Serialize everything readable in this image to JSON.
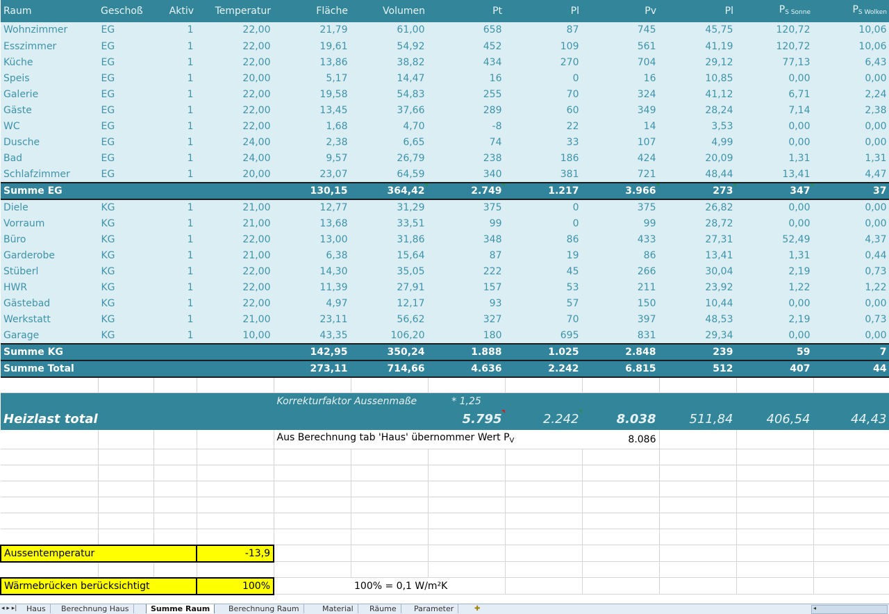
{
  "headers": {
    "raum": "Raum",
    "geschoss": "Geschoß",
    "aktiv": "Aktiv",
    "temperatur": "Temperatur",
    "flaeche": "Fläche",
    "volumen": "Volumen",
    "pt": "Pt",
    "pl": "Pl",
    "pv": "Pv",
    "pl2": "Pl",
    "ps_sonne_main": "P",
    "ps_sonne_sub": "S Sonne",
    "ps_wolken_main": "P",
    "ps_wolken_sub": "S Wolken"
  },
  "rooms_eg": [
    {
      "raum": "Wohnzimmer",
      "geschoss": "EG",
      "aktiv": "1",
      "temp": "22,00",
      "flaeche": "21,79",
      "volumen": "61,00",
      "pt": "658",
      "pl": "87",
      "pv": "745",
      "pl2": "45,75",
      "ps_sonne": "120,72",
      "ps_wolken": "10,06"
    },
    {
      "raum": "Esszimmer",
      "geschoss": "EG",
      "aktiv": "1",
      "temp": "22,00",
      "flaeche": "19,61",
      "volumen": "54,92",
      "pt": "452",
      "pl": "109",
      "pv": "561",
      "pl2": "41,19",
      "ps_sonne": "120,72",
      "ps_wolken": "10,06"
    },
    {
      "raum": "Küche",
      "geschoss": "EG",
      "aktiv": "1",
      "temp": "22,00",
      "flaeche": "13,86",
      "volumen": "38,82",
      "pt": "434",
      "pl": "270",
      "pv": "704",
      "pl2": "29,12",
      "ps_sonne": "77,13",
      "ps_wolken": "6,43"
    },
    {
      "raum": "Speis",
      "geschoss": "EG",
      "aktiv": "1",
      "temp": "20,00",
      "flaeche": "5,17",
      "volumen": "14,47",
      "pt": "16",
      "pl": "0",
      "pv": "16",
      "pl2": "10,85",
      "ps_sonne": "0,00",
      "ps_wolken": "0,00"
    },
    {
      "raum": "Galerie",
      "geschoss": "EG",
      "aktiv": "1",
      "temp": "22,00",
      "flaeche": "19,58",
      "volumen": "54,83",
      "pt": "255",
      "pl": "70",
      "pv": "324",
      "pl2": "41,12",
      "ps_sonne": "6,71",
      "ps_wolken": "2,24"
    },
    {
      "raum": "Gäste",
      "geschoss": "EG",
      "aktiv": "1",
      "temp": "22,00",
      "flaeche": "13,45",
      "volumen": "37,66",
      "pt": "289",
      "pl": "60",
      "pv": "349",
      "pl2": "28,24",
      "ps_sonne": "7,14",
      "ps_wolken": "2,38"
    },
    {
      "raum": "WC",
      "geschoss": "EG",
      "aktiv": "1",
      "temp": "22,00",
      "flaeche": "1,68",
      "volumen": "4,70",
      "pt": "-8",
      "pl": "22",
      "pv": "14",
      "pl2": "3,53",
      "ps_sonne": "0,00",
      "ps_wolken": "0,00"
    },
    {
      "raum": "Dusche",
      "geschoss": "EG",
      "aktiv": "1",
      "temp": "24,00",
      "flaeche": "2,38",
      "volumen": "6,65",
      "pt": "74",
      "pl": "33",
      "pv": "107",
      "pl2": "4,99",
      "ps_sonne": "0,00",
      "ps_wolken": "0,00"
    },
    {
      "raum": "Bad",
      "geschoss": "EG",
      "aktiv": "1",
      "temp": "24,00",
      "flaeche": "9,57",
      "volumen": "26,79",
      "pt": "238",
      "pl": "186",
      "pv": "424",
      "pl2": "20,09",
      "ps_sonne": "1,31",
      "ps_wolken": "1,31"
    },
    {
      "raum": "Schlafzimmer",
      "geschoss": "EG",
      "aktiv": "1",
      "temp": "20,00",
      "flaeche": "23,07",
      "volumen": "64,59",
      "pt": "340",
      "pl": "381",
      "pv": "721",
      "pl2": "48,44",
      "ps_sonne": "13,41",
      "ps_wolken": "4,47"
    }
  ],
  "summe_eg": {
    "label": "Summe EG",
    "flaeche": "130,15",
    "volumen": "364,42",
    "pt": "2.749",
    "pl": "1.217",
    "pv": "3.966",
    "pl2": "273",
    "ps_sonne": "347",
    "ps_wolken": "37"
  },
  "rooms_kg": [
    {
      "raum": "Diele",
      "geschoss": "KG",
      "aktiv": "1",
      "temp": "21,00",
      "flaeche": "12,77",
      "volumen": "31,29",
      "pt": "375",
      "pl": "0",
      "pv": "375",
      "pl2": "26,82",
      "ps_sonne": "0,00",
      "ps_wolken": "0,00"
    },
    {
      "raum": "Vorraum",
      "geschoss": "KG",
      "aktiv": "1",
      "temp": "21,00",
      "flaeche": "13,68",
      "volumen": "33,51",
      "pt": "99",
      "pl": "0",
      "pv": "99",
      "pl2": "28,72",
      "ps_sonne": "0,00",
      "ps_wolken": "0,00"
    },
    {
      "raum": "Büro",
      "geschoss": "KG",
      "aktiv": "1",
      "temp": "22,00",
      "flaeche": "13,00",
      "volumen": "31,86",
      "pt": "348",
      "pl": "86",
      "pv": "433",
      "pl2": "27,31",
      "ps_sonne": "52,49",
      "ps_wolken": "4,37"
    },
    {
      "raum": "Garderobe",
      "geschoss": "KG",
      "aktiv": "1",
      "temp": "21,00",
      "flaeche": "6,38",
      "volumen": "15,64",
      "pt": "87",
      "pl": "19",
      "pv": "86",
      "pl2": "13,41",
      "ps_sonne": "1,31",
      "ps_wolken": "0,44"
    },
    {
      "raum": "Stüberl",
      "geschoss": "KG",
      "aktiv": "1",
      "temp": "22,00",
      "flaeche": "14,30",
      "volumen": "35,05",
      "pt": "222",
      "pl": "45",
      "pv": "266",
      "pl2": "30,04",
      "ps_sonne": "2,19",
      "ps_wolken": "0,73"
    },
    {
      "raum": "HWR",
      "geschoss": "KG",
      "aktiv": "1",
      "temp": "22,00",
      "flaeche": "11,39",
      "volumen": "27,91",
      "pt": "157",
      "pl": "53",
      "pv": "211",
      "pl2": "23,92",
      "ps_sonne": "1,22",
      "ps_wolken": "1,22"
    },
    {
      "raum": "Gästebad",
      "geschoss": "KG",
      "aktiv": "1",
      "temp": "22,00",
      "flaeche": "4,97",
      "volumen": "12,17",
      "pt": "93",
      "pl": "57",
      "pv": "150",
      "pl2": "10,44",
      "ps_sonne": "0,00",
      "ps_wolken": "0,00"
    },
    {
      "raum": "Werkstatt",
      "geschoss": "KG",
      "aktiv": "1",
      "temp": "21,00",
      "flaeche": "23,11",
      "volumen": "56,62",
      "pt": "327",
      "pl": "70",
      "pv": "397",
      "pl2": "48,53",
      "ps_sonne": "2,19",
      "ps_wolken": "0,73"
    },
    {
      "raum": "Garage",
      "geschoss": "KG",
      "aktiv": "1",
      "temp": "10,00",
      "flaeche": "43,35",
      "volumen": "106,20",
      "pt": "180",
      "pl": "695",
      "pv": "831",
      "pl2": "29,34",
      "ps_sonne": "0,00",
      "ps_wolken": "0,00"
    }
  ],
  "summe_kg": {
    "label": "Summe KG",
    "flaeche": "142,95",
    "volumen": "350,24",
    "pt": "1.888",
    "pl": "1.025",
    "pv": "2.848",
    "pl2": "239",
    "ps_sonne": "59",
    "ps_wolken": "7"
  },
  "summe_total": {
    "label": "Summe Total",
    "flaeche": "273,11",
    "volumen": "714,66",
    "pt": "4.636",
    "pl": "2.242",
    "pv": "6.815",
    "pl2": "512",
    "ps_sonne": "407",
    "ps_wolken": "44"
  },
  "korrektur": {
    "label": "Korrekturfaktor Aussenmaße",
    "factor": "* 1,25"
  },
  "heizlast": {
    "label": "Heizlast total",
    "pt": "5.795",
    "pl": "2.242",
    "pv": "8.038",
    "pl2": "511,84",
    "ps_sonne": "406,54",
    "ps_wolken": "44,43"
  },
  "uebernommen": {
    "label_main": "Aus Berechnung tab 'Haus' übernommer Wert P",
    "label_sub": "V",
    "value": "8.086"
  },
  "aussentemperatur": {
    "label": "Aussentemperatur",
    "value": "-13,9"
  },
  "waermebruecken": {
    "label": "Wärmebrücken berücksichtigt",
    "value": "100%",
    "note": "100% = 0,1 W/m²K"
  },
  "tabs": [
    "Haus",
    "Berechnung Haus",
    "Summe Raum",
    "Berechnung Raum",
    "Material",
    "Räume",
    "Parameter"
  ],
  "active_tab": "Summe Raum",
  "nav_arrows": "◂ ▸ ▸|"
}
